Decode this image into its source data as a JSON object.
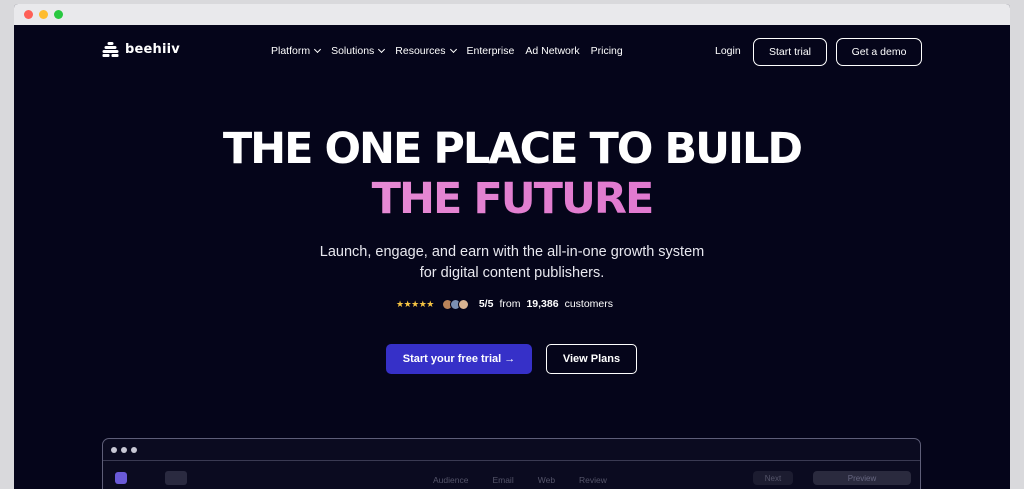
{
  "nav": {
    "logo_text": "beehiiv",
    "menu": [
      {
        "label": "Platform",
        "has_dropdown": true
      },
      {
        "label": "Solutions",
        "has_dropdown": true
      },
      {
        "label": "Resources",
        "has_dropdown": true
      },
      {
        "label": "Enterprise",
        "has_dropdown": false
      },
      {
        "label": "Ad Network",
        "has_dropdown": false
      },
      {
        "label": "Pricing",
        "has_dropdown": false
      }
    ],
    "login": "Login",
    "start_trial": "Start trial",
    "get_demo": "Get a demo"
  },
  "hero": {
    "title_line1": "THE ONE PLACE TO BUILD",
    "title_line2": "THE FUTURE",
    "subtitle": "Launch, engage, and earn with the all-in-one growth system for digital content publishers.",
    "rating": {
      "stars": "★★★★★",
      "score": "5/5",
      "from": "from",
      "count": "19,386",
      "suffix": "customers"
    },
    "cta_primary": "Start your free trial →",
    "cta_secondary": "View Plans"
  },
  "preview": {
    "tabs": [
      "Audience",
      "Email",
      "Web",
      "Review"
    ],
    "next_label": "Next",
    "preview_label": "Preview"
  },
  "colors": {
    "background": "#05051a",
    "primary_button": "#3630c8",
    "gradient_start": "#f1a6df",
    "gradient_end": "#dd6bcf",
    "star": "#f6c443"
  }
}
